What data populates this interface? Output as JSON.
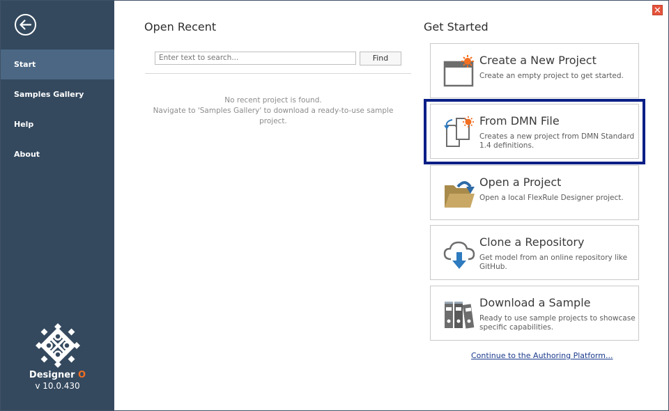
{
  "sidebar": {
    "back_icon": "back-arrow-icon",
    "items": [
      {
        "label": "Start",
        "active": true
      },
      {
        "label": "Samples Gallery",
        "active": false
      },
      {
        "label": "Help",
        "active": false
      },
      {
        "label": "About",
        "active": false
      }
    ],
    "brand": {
      "name": "Designer",
      "name_suffix": "O",
      "version": "v 10.0.430"
    }
  },
  "window": {
    "close_icon": "close-icon",
    "close_glyph": "✕"
  },
  "open_recent": {
    "title": "Open Recent",
    "search_placeholder": "Enter text to search...",
    "find_label": "Find",
    "empty_line1": "No recent project is found.",
    "empty_line2": "Navigate to 'Samples Gallery' to download a ready-to-use sample project."
  },
  "get_started": {
    "title": "Get Started",
    "cards": [
      {
        "title": "Create a New Project",
        "description": "Create an empty project to get started.",
        "icon": "new-project-icon"
      },
      {
        "title": "From DMN File",
        "description": "Creates a new project from DMN Standard 1.4 definitions.",
        "icon": "dmn-file-icon"
      },
      {
        "title": "Open a Project",
        "description": "Open a local FlexRule Designer project.",
        "icon": "open-folder-icon"
      },
      {
        "title": "Clone a Repository",
        "description": "Get model from an online repository like GitHub.",
        "icon": "cloud-download-icon"
      },
      {
        "title": "Download a Sample",
        "description": "Ready to use sample projects to showcase specific capabilities.",
        "icon": "binders-icon"
      }
    ],
    "continue_link": "Continue to the Authoring Platform..."
  },
  "colors": {
    "sidebar": "#34495e",
    "sidebar_active": "#4b6783",
    "accent_orange": "#f36f21",
    "highlight_border": "#0a1f86",
    "link": "#1a3a8c"
  }
}
